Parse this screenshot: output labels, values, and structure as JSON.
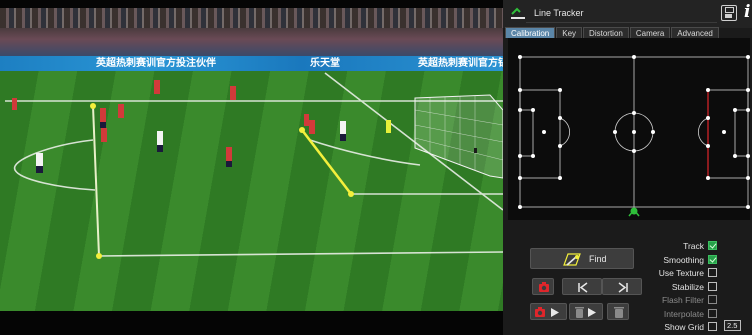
{
  "app": {
    "title": "Line Tracker"
  },
  "video": {
    "adboard_texts": [
      "英超热刺赛训官方投注伙伴",
      "乐天堂",
      "英超热刺赛训官方钻石"
    ]
  },
  "tabs": [
    {
      "label": "Calibration",
      "active": true
    },
    {
      "label": "Key",
      "active": false
    },
    {
      "label": "Distortion",
      "active": false
    },
    {
      "label": "Camera",
      "active": false
    },
    {
      "label": "Advanced",
      "active": false
    }
  ],
  "controls": {
    "find_label": "Find",
    "options": [
      {
        "label": "Track",
        "checked": true,
        "enabled": true
      },
      {
        "label": "Smoothing",
        "checked": true,
        "enabled": true
      },
      {
        "label": "Use Texture",
        "checked": false,
        "enabled": true
      },
      {
        "label": "Stabilize",
        "checked": false,
        "enabled": true
      },
      {
        "label": "Flash Filter",
        "checked": false,
        "enabled": false
      },
      {
        "label": "Interpolate",
        "checked": false,
        "enabled": false
      },
      {
        "label": "Show Grid",
        "checked": false,
        "enabled": true
      }
    ],
    "grid_value": "2.5"
  },
  "colors": {
    "accent_tab": "#5b86a8",
    "check_on": "#27a04a",
    "tracker_line": "#f3ef3c",
    "camera_red": "#e0262b",
    "minimap_marker": "#2fbf3a"
  },
  "icons": {
    "title": "line-tracker-logo-icon",
    "save": "floppy-disk-icon",
    "info": "info-icon",
    "find": "magic-wand-icon",
    "snapshot": "camera-icon",
    "prev": "previous-key-icon",
    "next": "next-key-icon",
    "record_play": "camera-play-icon",
    "delete_play": "trash-play-icon",
    "delete": "trash-icon"
  }
}
